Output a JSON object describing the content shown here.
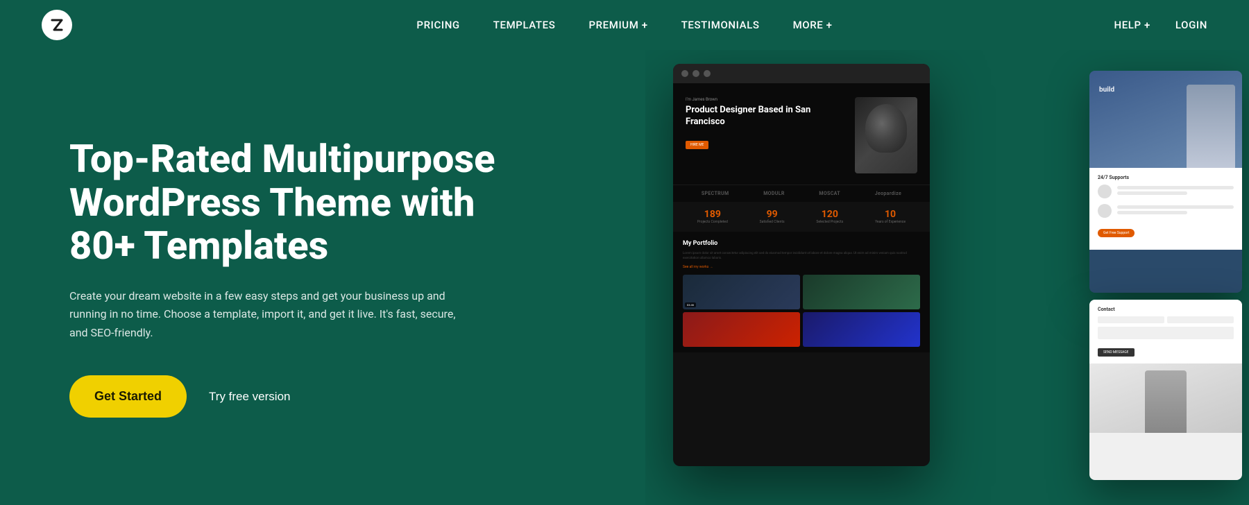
{
  "nav": {
    "logo_symbol": "Z",
    "center_items": [
      {
        "label": "PRICING",
        "id": "pricing"
      },
      {
        "label": "TEMPLATES",
        "id": "templates"
      },
      {
        "label": "PREMIUM +",
        "id": "premium"
      },
      {
        "label": "TESTIMONIALS",
        "id": "testimonials"
      },
      {
        "label": "MORE +",
        "id": "more"
      }
    ],
    "right_items": [
      {
        "label": "HELP +",
        "id": "help"
      },
      {
        "label": "LOGIN",
        "id": "login"
      }
    ]
  },
  "hero": {
    "title": "Top-Rated Multipurpose WordPress Theme with 80+ Templates",
    "subtitle": "Create your dream website in a few easy steps and get your business up and running in no time. Choose a template, import it, and get it live. It's fast, secure, and SEO-friendly.",
    "cta_primary": "Get Started",
    "cta_secondary": "Try free version"
  },
  "mockup": {
    "person_label": "I'm James Brown",
    "big_title": "Product Designer Based in San Francisco",
    "orange_btn": "HIRE ME",
    "brands": [
      "SPECTRUM",
      "MODULR",
      "MOSCAT",
      "Jeopardize"
    ],
    "stats": [
      {
        "num": "189",
        "label": "Projects\nCompleted"
      },
      {
        "num": "99",
        "label": "Satisfied\nClients"
      },
      {
        "num": "120",
        "label": "Selected\nProjects"
      },
      {
        "num": "10",
        "label": "Years of\nExperience"
      }
    ],
    "portfolio_title": "My Portfolio",
    "portfolio_link": "See all my works →"
  },
  "side1": {
    "build_text": "build",
    "support_label": "24/7 Supports",
    "free_label": "Get Free Support"
  },
  "side2": {
    "title": "Contact",
    "submit": "SEND MESSAGE"
  }
}
